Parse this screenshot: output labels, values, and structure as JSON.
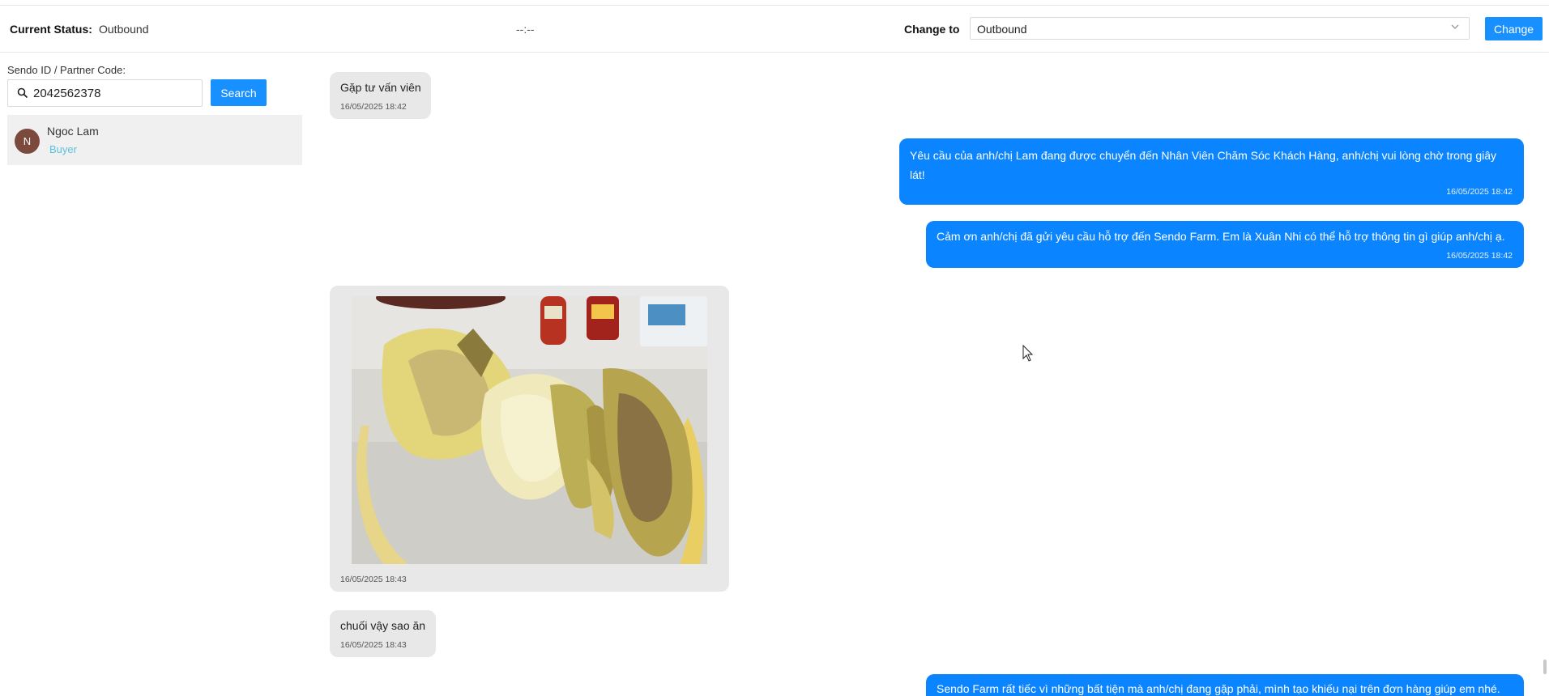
{
  "header": {
    "current_status_label": "Current Status:",
    "current_status_value": "Outbound",
    "timer": "--:--",
    "change_to_label": "Change to",
    "change_to_selected": "Outbound",
    "change_button": "Change"
  },
  "search": {
    "label": "Sendo ID / Partner Code:",
    "value": "2042562378",
    "button": "Search"
  },
  "contacts": [
    {
      "initial": "N",
      "name": "Ngoc Lam",
      "role": "Buyer"
    }
  ],
  "messages": [
    {
      "direction": "incoming",
      "text": "Gặp tư vấn viên",
      "time": "16/05/2025 18:42"
    },
    {
      "direction": "outgoing",
      "text": "Yêu cầu của anh/chị Lam đang được chuyển đến Nhân Viên Chăm Sóc Khách Hàng, anh/chị vui lòng chờ trong giây lát!",
      "time": "16/05/2025 18:42"
    },
    {
      "direction": "outgoing",
      "text": "Cảm ơn anh/chị đã gửi yêu cầu hỗ trợ đến Sendo Farm. Em là Xuân Nhi có thể hỗ trợ thông tin gì giúp anh/chị ạ.",
      "time": "16/05/2025 18:42"
    },
    {
      "direction": "incoming",
      "type": "image",
      "time": "16/05/2025 18:43"
    },
    {
      "direction": "incoming",
      "text": "chuối vậy sao ăn",
      "time": "16/05/2025 18:43"
    },
    {
      "direction": "outgoing",
      "text": "Sendo Farm rất tiếc vì những bất tiện mà anh/chị đang gặp phải, mình tạo khiếu nại trên đơn hàng giúp em nhé.",
      "time": ""
    }
  ],
  "colors": {
    "accent": "#1890ff",
    "outgoing_bubble": "#0a84ff",
    "incoming_bubble": "#e8e8e8",
    "buyer_role": "#5bc0de",
    "avatar": "#7b4a3d"
  },
  "icons": [
    "search-icon",
    "chevron-down-icon",
    "mouse-cursor-icon"
  ]
}
